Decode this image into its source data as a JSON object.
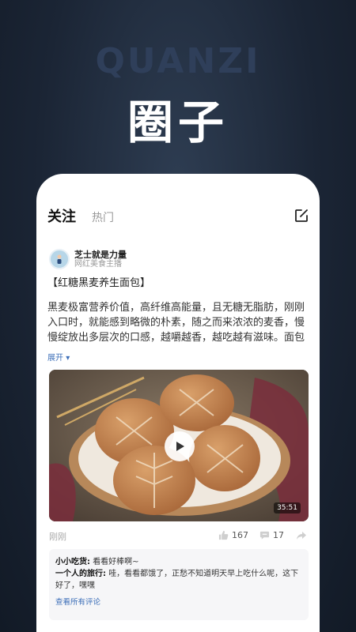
{
  "hero": {
    "title_en": "QUANZI",
    "title_cn": "圈子"
  },
  "tabs": {
    "active": "关注",
    "other": "热门"
  },
  "icons": {
    "compose": "compose-icon",
    "play": "play-icon",
    "like": "thumbs-up-icon",
    "comment": "comment-icon",
    "share": "share-arrow-icon"
  },
  "author": {
    "name": "芝士就是力量",
    "role": "网红美食主播"
  },
  "post": {
    "title": "【红糖黑麦养生面包】",
    "body": "黑麦极富营养价值，高纤维高能量，且无糖无脂肪，刚刚入口时，就能感到略微的朴素，随之而来浓浓的麦香，慢慢绽放出多层次的口感，越嚼越香，越吃越有滋味。面包",
    "expand": "展开",
    "video_duration": "35:51",
    "time": "刚刚",
    "likes": "167",
    "comments": "17"
  },
  "comments": [
    {
      "name": "小小吃货:",
      "text": "看看好棒啊~"
    },
    {
      "name": "一个人的旅行:",
      "text": "哇，看看都饿了，正愁不知道明天早上吃什么呢，这下好了，嘿嘿"
    }
  ],
  "view_all": "查看所有评论",
  "colors": {
    "accent": "#3d6fb8",
    "background": "#1b2535"
  }
}
